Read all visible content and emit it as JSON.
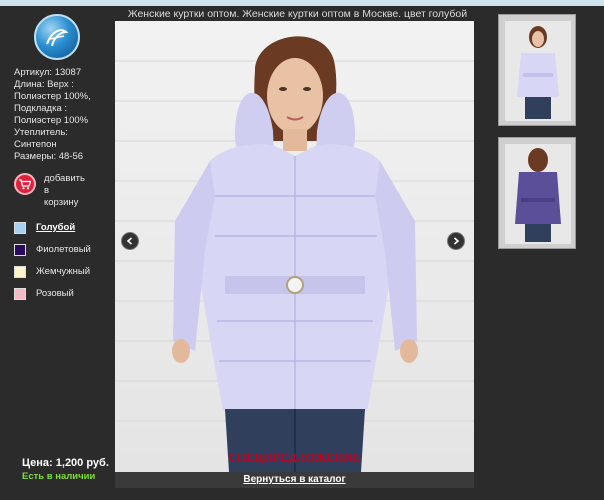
{
  "title": "Женские куртки оптом. Женские куртки оптом в Москве. цвет голубой",
  "specs": [
    "Артикул: 13087",
    "Длина: Верх :",
    "Полиэстер 100%,",
    "Подкладка :",
    "Полиэстер 100%",
    "Утеплитель:",
    "Синтепон",
    "Размеры: 48-56"
  ],
  "cart": {
    "line1": "добавить",
    "line2": "в",
    "line3": "корзину",
    "icon": "cart-icon"
  },
  "colors": [
    {
      "label": "Голубой",
      "color": "#a8d0f0",
      "active": true
    },
    {
      "label": "Фиолетовый",
      "color": "#2a0a5e",
      "active": false
    },
    {
      "label": "Жемчужный",
      "color": "#fff4c8",
      "active": false
    },
    {
      "label": "Розовый",
      "color": "#f6b8c4",
      "active": false
    }
  ],
  "price": "Цена: 1,200 руб.",
  "stock": "Есть в наличии",
  "special_offer": "СПЕЦПРЕДЛОЖЕНИЕ",
  "back_link": "Вернуться в каталог",
  "icons": {
    "prev": "chevron-left-icon",
    "next": "chevron-right-icon",
    "logo": "brand-logo-icon"
  },
  "accent": {
    "stock_green": "#7fdc3a",
    "special_red": "#c8001e",
    "cart_red": "#e0213c"
  }
}
